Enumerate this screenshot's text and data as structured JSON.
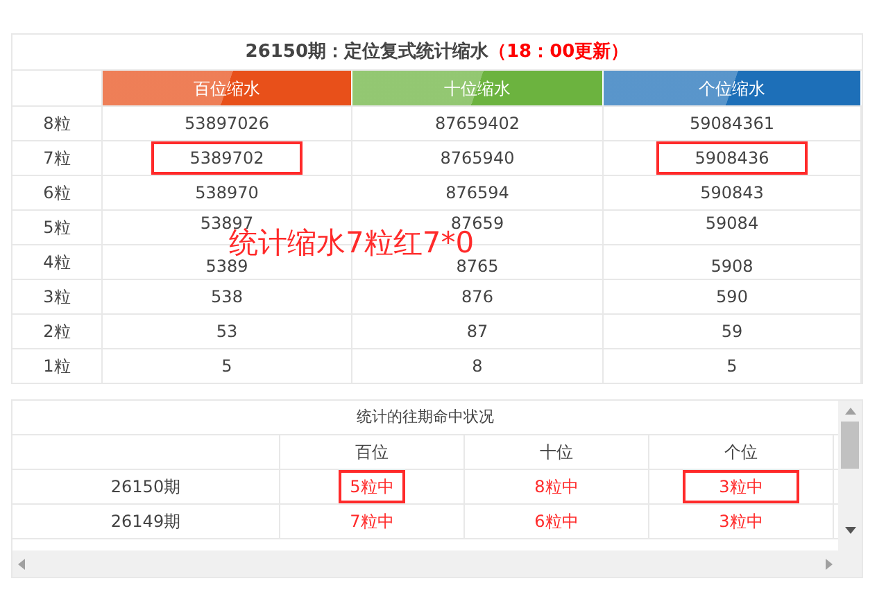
{
  "summary_table": {
    "title": "26150期：定位复式统计缩水",
    "title_note": "（18：00更新）",
    "columns": [
      {
        "label": "百位缩水",
        "color": "#e8501a"
      },
      {
        "label": "十位缩水",
        "color": "#6cb33f"
      },
      {
        "label": "个位缩水",
        "color": "#1d6fb8"
      }
    ],
    "rows": [
      {
        "label": "8粒",
        "cells": [
          {
            "text": "53897026",
            "highlighted": false
          },
          {
            "text": "87659402",
            "highlighted": false
          },
          {
            "text": "59084361",
            "highlighted": false
          }
        ]
      },
      {
        "label": "7粒",
        "cells": [
          {
            "text": "5389702",
            "highlighted": true
          },
          {
            "text": "8765940",
            "highlighted": false
          },
          {
            "text": "5908436",
            "highlighted": true
          }
        ]
      },
      {
        "label": "6粒",
        "cells": [
          {
            "text": "538970",
            "highlighted": false
          },
          {
            "text": "876594",
            "highlighted": false
          },
          {
            "text": "590843",
            "highlighted": false
          }
        ]
      },
      {
        "label": "5粒",
        "cells": [
          {
            "text": "53897",
            "highlighted": false
          },
          {
            "text": "87659",
            "highlighted": false
          },
          {
            "text": "59084",
            "highlighted": false
          }
        ]
      },
      {
        "label": "4粒",
        "cells": [
          {
            "text": "5389",
            "highlighted": false
          },
          {
            "text": "8765",
            "highlighted": false
          },
          {
            "text": "5908",
            "highlighted": false
          }
        ]
      },
      {
        "label": "3粒",
        "cells": [
          {
            "text": "538",
            "highlighted": false
          },
          {
            "text": "876",
            "highlighted": false
          },
          {
            "text": "590",
            "highlighted": false
          }
        ]
      },
      {
        "label": "2粒",
        "cells": [
          {
            "text": "53",
            "highlighted": false
          },
          {
            "text": "87",
            "highlighted": false
          },
          {
            "text": "59",
            "highlighted": false
          }
        ]
      },
      {
        "label": "1粒",
        "cells": [
          {
            "text": "5",
            "highlighted": false
          },
          {
            "text": "8",
            "highlighted": false
          },
          {
            "text": "5",
            "highlighted": false
          }
        ]
      }
    ]
  },
  "annotation": "统计缩水7粒红7*0",
  "history_table": {
    "title": "统计的往期命中状况",
    "columns": [
      "百位",
      "十位",
      "个位"
    ],
    "rows": [
      {
        "period": "26150期",
        "cells": [
          {
            "text": "5粒中",
            "highlighted": true
          },
          {
            "text": "8粒中",
            "highlighted": false
          },
          {
            "text": "3粒中",
            "highlighted": true
          }
        ]
      },
      {
        "period": "26149期",
        "cells": [
          {
            "text": "7粒中",
            "highlighted": false
          },
          {
            "text": "6粒中",
            "highlighted": false
          },
          {
            "text": "3粒中",
            "highlighted": false
          }
        ]
      }
    ]
  }
}
